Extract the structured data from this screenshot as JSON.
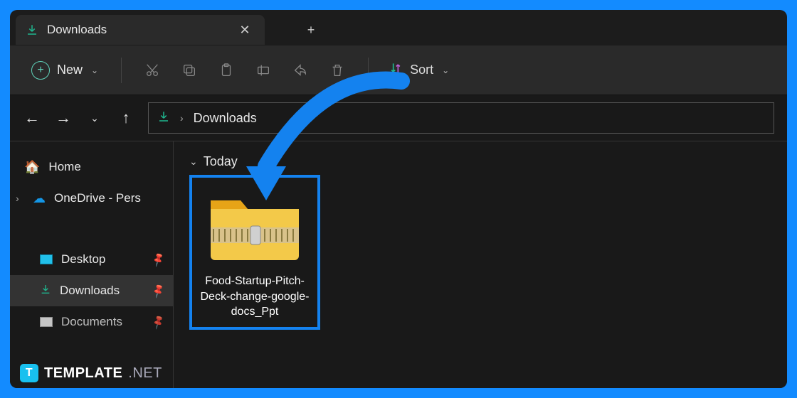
{
  "tab": {
    "title": "Downloads"
  },
  "toolbar": {
    "new_label": "New",
    "sort_label": "Sort"
  },
  "breadcrumb": {
    "current": "Downloads"
  },
  "sidebar": {
    "home": "Home",
    "onedrive": "OneDrive - Pers",
    "desktop": "Desktop",
    "downloads": "Downloads",
    "documents": "Documents"
  },
  "content": {
    "group": "Today",
    "file": {
      "name": "Food-Startup-Pitch-Deck-change-google-docs_Ppt"
    }
  },
  "watermark": {
    "brand": "TEMPLATE",
    "suffix": ".NET",
    "badge": "T"
  }
}
